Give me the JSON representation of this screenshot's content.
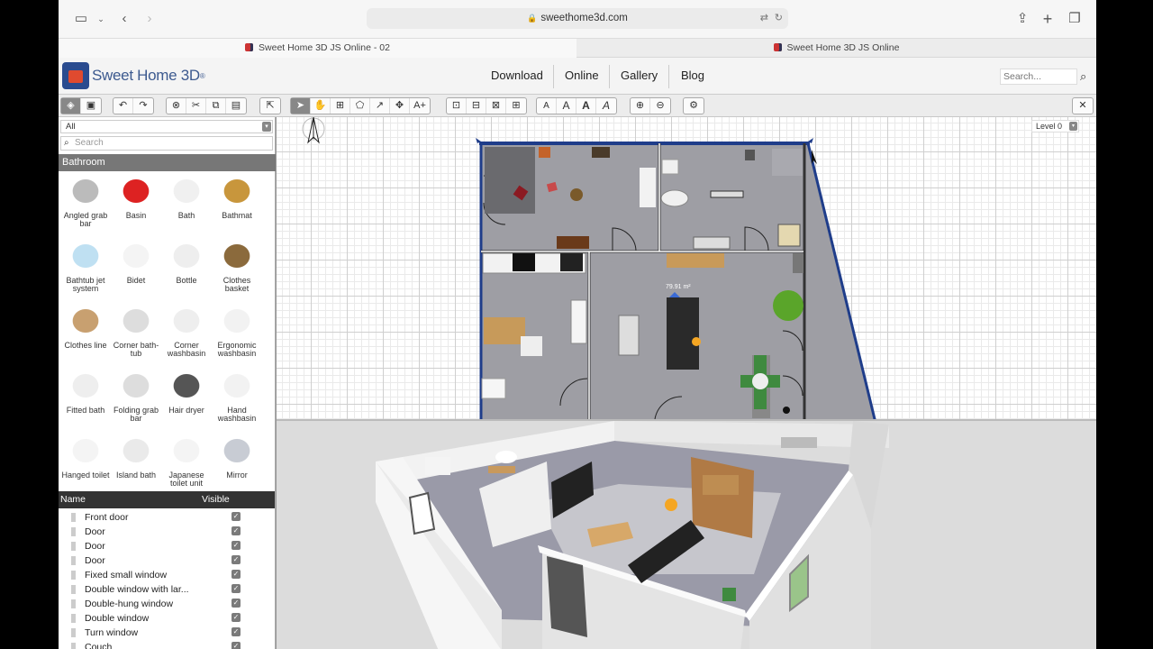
{
  "browser": {
    "url": "sweethome3d.com",
    "tabs": [
      {
        "title": "Sweet Home 3D JS Online - 02",
        "active": true
      },
      {
        "title": "Sweet Home 3D JS Online",
        "active": false
      }
    ]
  },
  "site": {
    "logo_text": "Sweet Home 3D",
    "logo_mark": "®",
    "nav": [
      "Download",
      "Online",
      "Gallery",
      "Blog"
    ],
    "search_placeholder": "Search..."
  },
  "catalog": {
    "filter_value": "All",
    "search_placeholder": "Search",
    "category": "Bathroom",
    "items": [
      {
        "label": "Angled grab bar",
        "icon": "grab-bar-icon"
      },
      {
        "label": "Basin",
        "icon": "basin-icon"
      },
      {
        "label": "Bath",
        "icon": "bath-icon"
      },
      {
        "label": "Bathmat",
        "icon": "bathmat-icon"
      },
      {
        "label": "Bathtub jet system",
        "icon": "bathtub-icon"
      },
      {
        "label": "Bidet",
        "icon": "bidet-icon"
      },
      {
        "label": "Bottle",
        "icon": "bottle-icon"
      },
      {
        "label": "Clothes basket",
        "icon": "basket-icon"
      },
      {
        "label": "Clothes line",
        "icon": "clothes-line-icon"
      },
      {
        "label": "Corner bath-tub",
        "icon": "corner-bath-icon"
      },
      {
        "label": "Corner washbasin",
        "icon": "corner-washbasin-icon"
      },
      {
        "label": "Ergonomic washbasin",
        "icon": "ergonomic-washbasin-icon"
      },
      {
        "label": "Fitted bath",
        "icon": "fitted-bath-icon"
      },
      {
        "label": "Folding grab bar",
        "icon": "folding-grab-bar-icon"
      },
      {
        "label": "Hair dryer",
        "icon": "hair-dryer-icon"
      },
      {
        "label": "Hand washbasin",
        "icon": "hand-washbasin-icon"
      },
      {
        "label": "Hanged toilet",
        "icon": "hanged-toilet-icon"
      },
      {
        "label": "Island bath",
        "icon": "island-bath-icon"
      },
      {
        "label": "Japanese toilet unit",
        "icon": "japanese-toilet-icon"
      },
      {
        "label": "Mirror",
        "icon": "mirror-icon"
      }
    ]
  },
  "furniture_table": {
    "col_name": "Name",
    "col_visible": "Visible",
    "rows": [
      {
        "name": "Front door",
        "visible": true
      },
      {
        "name": "Door",
        "visible": true
      },
      {
        "name": "Door",
        "visible": true
      },
      {
        "name": "Door",
        "visible": true
      },
      {
        "name": "Fixed small window",
        "visible": true
      },
      {
        "name": "Double window with lar...",
        "visible": true
      },
      {
        "name": "Double-hung window",
        "visible": true
      },
      {
        "name": "Double window",
        "visible": true
      },
      {
        "name": "Turn window",
        "visible": true
      },
      {
        "name": "Couch",
        "visible": true
      }
    ]
  },
  "plan": {
    "level": "Level 0",
    "room_area_label": "79.91 m²"
  },
  "toolbar": {
    "mode_buttons": [
      "select-icon",
      "pan-icon",
      "create-walls-icon",
      "create-rooms-icon",
      "create-polylines-icon",
      "create-dimensions-icon",
      "add-text-icon"
    ],
    "text_buttons": [
      "A",
      "A",
      "A",
      "A"
    ]
  }
}
